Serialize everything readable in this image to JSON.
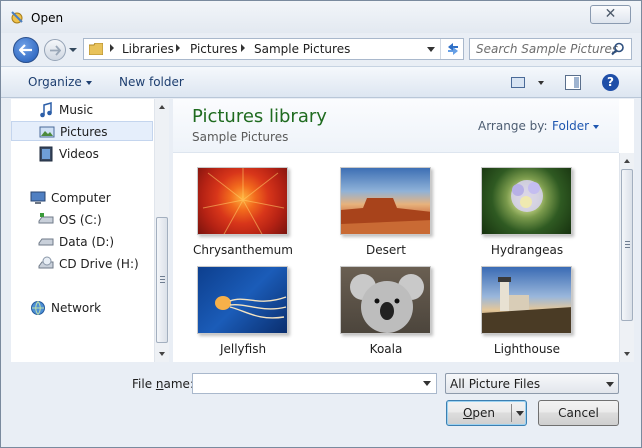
{
  "window": {
    "title": "Open",
    "close_glyph": "✕"
  },
  "address_bar": {
    "breadcrumbs": [
      "Libraries",
      "Pictures",
      "Sample Pictures"
    ]
  },
  "search": {
    "placeholder": "Search Sample Pictures"
  },
  "toolbar": {
    "organize_label": "Organize",
    "new_folder_label": "New folder",
    "help_glyph": "?"
  },
  "nav_pane": {
    "items": [
      {
        "label": "Music",
        "icon": "music-icon",
        "selected": false
      },
      {
        "label": "Pictures",
        "icon": "pictures-icon",
        "selected": true
      },
      {
        "label": "Videos",
        "icon": "videos-icon",
        "selected": false
      },
      {
        "label": "Computer",
        "icon": "computer-icon",
        "selected": false
      },
      {
        "label": "OS (C:)",
        "icon": "drive-icon",
        "selected": false
      },
      {
        "label": "Data (D:)",
        "icon": "drive-icon",
        "selected": false
      },
      {
        "label": "CD Drive (H:)",
        "icon": "cd-drive-icon",
        "selected": false
      },
      {
        "label": "Network",
        "icon": "network-icon",
        "selected": false
      }
    ]
  },
  "library": {
    "title": "Pictures library",
    "subtitle": "Sample Pictures",
    "arrange_label": "Arrange by:",
    "arrange_value": "Folder"
  },
  "files": [
    {
      "name": "Chrysanthemum"
    },
    {
      "name": "Desert"
    },
    {
      "name": "Hydrangeas"
    },
    {
      "name": "Jellyfish"
    },
    {
      "name": "Koala"
    },
    {
      "name": "Lighthouse"
    }
  ],
  "footer": {
    "file_name_label_pre": "File ",
    "file_name_label_key": "n",
    "file_name_label_post": "ame:",
    "file_name_value": "",
    "filter_value": "All Picture Files",
    "open_label_key": "O",
    "open_label_rest": "pen",
    "cancel_label": "Cancel"
  },
  "colors": {
    "library_title": "#1f6b1f",
    "selection": "#e5eefb",
    "accent": "#1f57b0"
  }
}
